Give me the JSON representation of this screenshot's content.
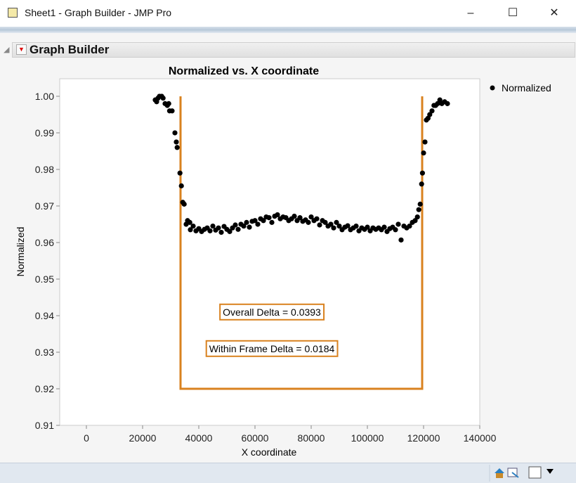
{
  "window": {
    "title": "Sheet1 - Graph Builder - JMP Pro",
    "minimize": "–",
    "maximize": "☐",
    "close": "✕"
  },
  "panel": {
    "title": "Graph Builder"
  },
  "chart_data": {
    "type": "scatter",
    "title": "Normalized vs. X coordinate",
    "xlabel": "X coordinate",
    "ylabel": "Normalized",
    "xlim": [
      -9500,
      140000
    ],
    "ylim": [
      0.91,
      1.0048
    ],
    "xticks": [
      0,
      20000,
      40000,
      60000,
      80000,
      100000,
      120000,
      140000
    ],
    "xtick_labels": [
      "0",
      "20000",
      "40000",
      "60000",
      "80000",
      "100000",
      "120000",
      "140000"
    ],
    "yticks": [
      1.0,
      0.99,
      0.98,
      0.97,
      0.96,
      0.95,
      0.94,
      0.93,
      0.92,
      0.91
    ],
    "ytick_labels": [
      "1.00",
      "0.99",
      "0.98",
      "0.97",
      "0.96",
      "0.95",
      "0.94",
      "0.93",
      "0.92",
      "0.91"
    ],
    "legend": {
      "position": "right",
      "entries": [
        "Normalized"
      ]
    },
    "series": [
      {
        "name": "Normalized",
        "points": [
          [
            24500,
            0.999
          ],
          [
            25000,
            0.9985
          ],
          [
            25500,
            0.9995
          ],
          [
            26000,
            1.0
          ],
          [
            26800,
            1.0
          ],
          [
            27300,
            0.9995
          ],
          [
            28000,
            0.998
          ],
          [
            28800,
            0.9975
          ],
          [
            29300,
            0.998
          ],
          [
            29600,
            0.996
          ],
          [
            30500,
            0.996
          ],
          [
            31500,
            0.99
          ],
          [
            32000,
            0.9875
          ],
          [
            32300,
            0.986
          ],
          [
            33300,
            0.979
          ],
          [
            33800,
            0.9755
          ],
          [
            34300,
            0.971
          ],
          [
            34800,
            0.9705
          ],
          [
            35500,
            0.965
          ],
          [
            36000,
            0.966
          ],
          [
            36800,
            0.9655
          ],
          [
            37000,
            0.9635
          ],
          [
            38000,
            0.9645
          ],
          [
            39000,
            0.9632
          ],
          [
            40000,
            0.9638
          ],
          [
            41000,
            0.963
          ],
          [
            42000,
            0.9636
          ],
          [
            43000,
            0.964
          ],
          [
            44000,
            0.9632
          ],
          [
            45000,
            0.9645
          ],
          [
            46000,
            0.9634
          ],
          [
            47000,
            0.964
          ],
          [
            48000,
            0.9628
          ],
          [
            49000,
            0.9644
          ],
          [
            50000,
            0.9636
          ],
          [
            51000,
            0.963
          ],
          [
            52000,
            0.964
          ],
          [
            53000,
            0.9648
          ],
          [
            54000,
            0.9636
          ],
          [
            55000,
            0.965
          ],
          [
            56000,
            0.9645
          ],
          [
            57000,
            0.9655
          ],
          [
            58000,
            0.9642
          ],
          [
            59000,
            0.9658
          ],
          [
            60000,
            0.966
          ],
          [
            61000,
            0.965
          ],
          [
            62000,
            0.9665
          ],
          [
            63000,
            0.966
          ],
          [
            64000,
            0.967
          ],
          [
            65000,
            0.9668
          ],
          [
            66000,
            0.9655
          ],
          [
            67000,
            0.9672
          ],
          [
            68000,
            0.9676
          ],
          [
            69000,
            0.9665
          ],
          [
            70000,
            0.967
          ],
          [
            71000,
            0.9668
          ],
          [
            72000,
            0.966
          ],
          [
            73000,
            0.9665
          ],
          [
            74000,
            0.9672
          ],
          [
            75000,
            0.966
          ],
          [
            76000,
            0.9668
          ],
          [
            77000,
            0.9658
          ],
          [
            78000,
            0.9662
          ],
          [
            79000,
            0.9655
          ],
          [
            80000,
            0.967
          ],
          [
            81000,
            0.966
          ],
          [
            82000,
            0.9665
          ],
          [
            83000,
            0.9648
          ],
          [
            84000,
            0.966
          ],
          [
            85000,
            0.9655
          ],
          [
            86000,
            0.9645
          ],
          [
            87000,
            0.965
          ],
          [
            88000,
            0.964
          ],
          [
            89000,
            0.9655
          ],
          [
            90000,
            0.9645
          ],
          [
            91000,
            0.9635
          ],
          [
            92000,
            0.9642
          ],
          [
            93000,
            0.9646
          ],
          [
            94000,
            0.9635
          ],
          [
            95000,
            0.964
          ],
          [
            96000,
            0.9645
          ],
          [
            97000,
            0.9632
          ],
          [
            98000,
            0.964
          ],
          [
            99000,
            0.9636
          ],
          [
            100000,
            0.9642
          ],
          [
            101000,
            0.9632
          ],
          [
            102000,
            0.964
          ],
          [
            103000,
            0.9636
          ],
          [
            104000,
            0.964
          ],
          [
            105000,
            0.9635
          ],
          [
            106000,
            0.9642
          ],
          [
            107000,
            0.963
          ],
          [
            108000,
            0.9638
          ],
          [
            109000,
            0.9642
          ],
          [
            110000,
            0.9635
          ],
          [
            111000,
            0.965
          ],
          [
            112000,
            0.9607
          ],
          [
            113000,
            0.9645
          ],
          [
            114000,
            0.964
          ],
          [
            115000,
            0.9645
          ],
          [
            116000,
            0.9655
          ],
          [
            117000,
            0.966
          ],
          [
            117800,
            0.967
          ],
          [
            118300,
            0.969
          ],
          [
            118800,
            0.9705
          ],
          [
            119300,
            0.976
          ],
          [
            119600,
            0.979
          ],
          [
            120000,
            0.9845
          ],
          [
            120500,
            0.9875
          ],
          [
            121000,
            0.9935
          ],
          [
            121600,
            0.994
          ],
          [
            122200,
            0.995
          ],
          [
            123000,
            0.996
          ],
          [
            123700,
            0.9975
          ],
          [
            124300,
            0.9975
          ],
          [
            125000,
            0.998
          ],
          [
            125800,
            0.999
          ],
          [
            126500,
            0.998
          ],
          [
            127500,
            0.9985
          ],
          [
            128500,
            0.998
          ]
        ]
      }
    ],
    "frame": {
      "x_left": 33500,
      "x_right": 119500,
      "y_bottom": 0.92,
      "y_top": 1.0,
      "color": "#d9821f"
    },
    "annotations": [
      {
        "text": "Overall Delta = 0.0393",
        "x": 66000,
        "y": 0.941
      },
      {
        "text": "Within Frame Delta = 0.0184",
        "x": 66000,
        "y": 0.931
      }
    ],
    "point_color": "#000000"
  }
}
